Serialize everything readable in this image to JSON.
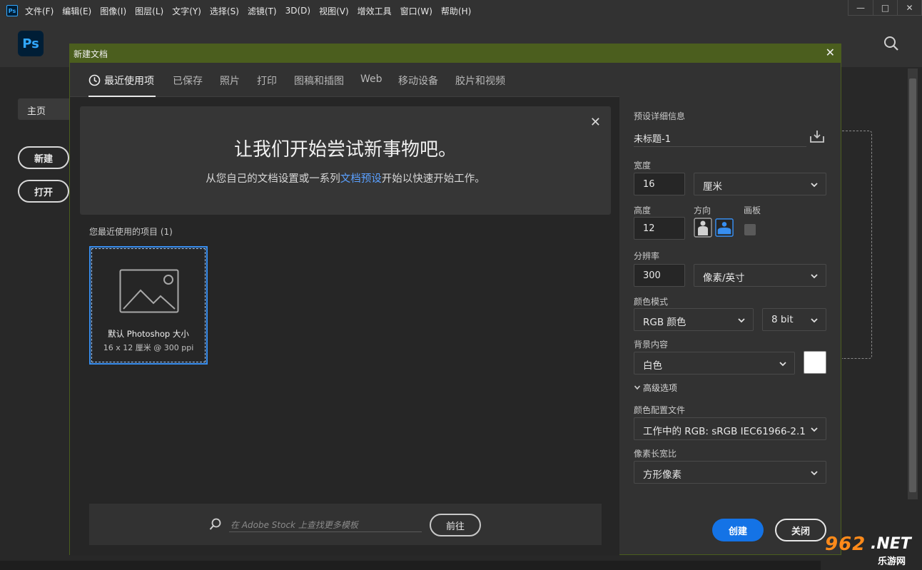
{
  "menubar": {
    "app_icon": "Ps",
    "items": [
      "文件(F)",
      "编辑(E)",
      "图像(I)",
      "图层(L)",
      "文字(Y)",
      "选择(S)",
      "滤镜(T)",
      "3D(D)",
      "视图(V)",
      "增效工具",
      "窗口(W)",
      "帮助(H)"
    ],
    "window_controls": {
      "minimize": "—",
      "maximize": "□",
      "close": "✕"
    }
  },
  "home": {
    "logo": "Ps",
    "home_tab": "主页",
    "new_button": "新建",
    "open_button": "打开"
  },
  "dialog": {
    "title": "新建文档",
    "close": "✕",
    "tabs": [
      {
        "label": "最近使用项"
      },
      {
        "label": "已保存"
      },
      {
        "label": "照片"
      },
      {
        "label": "打印"
      },
      {
        "label": "图稿和插图"
      },
      {
        "label": "Web"
      },
      {
        "label": "移动设备"
      },
      {
        "label": "胶片和视频"
      }
    ],
    "banner": {
      "title": "让我们开始尝试新事物吧。",
      "sub_before": "从您自己的文档设置或一系列",
      "sub_link": "文档预设",
      "sub_after": "开始以快速开始工作。",
      "close": "✕"
    },
    "recent": {
      "label": "您最近使用的项目 (1)",
      "presets": [
        {
          "name": "默认 Photoshop 大小",
          "size": "16 x 12 厘米 @ 300 ppi"
        }
      ]
    },
    "stock": {
      "placeholder": "在 Adobe Stock 上查找更多模板",
      "go_button": "前往"
    },
    "details": {
      "heading": "预设详细信息",
      "doc_name": "未标题-1",
      "width_label": "宽度",
      "width_value": "16",
      "unit": "厘米",
      "height_label": "高度",
      "height_value": "12",
      "orientation_label": "方向",
      "artboard_label": "画板",
      "artboard_checked": false,
      "resolution_label": "分辨率",
      "resolution_value": "300",
      "resolution_unit": "像素/英寸",
      "color_mode_label": "颜色模式",
      "color_mode": "RGB 颜色",
      "bit_depth": "8 bit",
      "background_label": "背景内容",
      "background": "白色",
      "background_color": "#ffffff",
      "advanced_label": "高级选项",
      "color_profile_label": "颜色配置文件",
      "color_profile": "工作中的 RGB: sRGB IEC61966-2.1",
      "pixel_aspect_label": "像素长宽比",
      "pixel_aspect": "方形像素",
      "create_button": "创建",
      "close_button": "关闭"
    }
  },
  "watermark": {
    "number": "962",
    "net": ".NET",
    "sub": "乐游网"
  },
  "colors": {
    "accent": "#1473e6",
    "dialog_title": "#4b5e1e",
    "link": "#5aa0ff",
    "ps_blue": "#31a8ff"
  }
}
